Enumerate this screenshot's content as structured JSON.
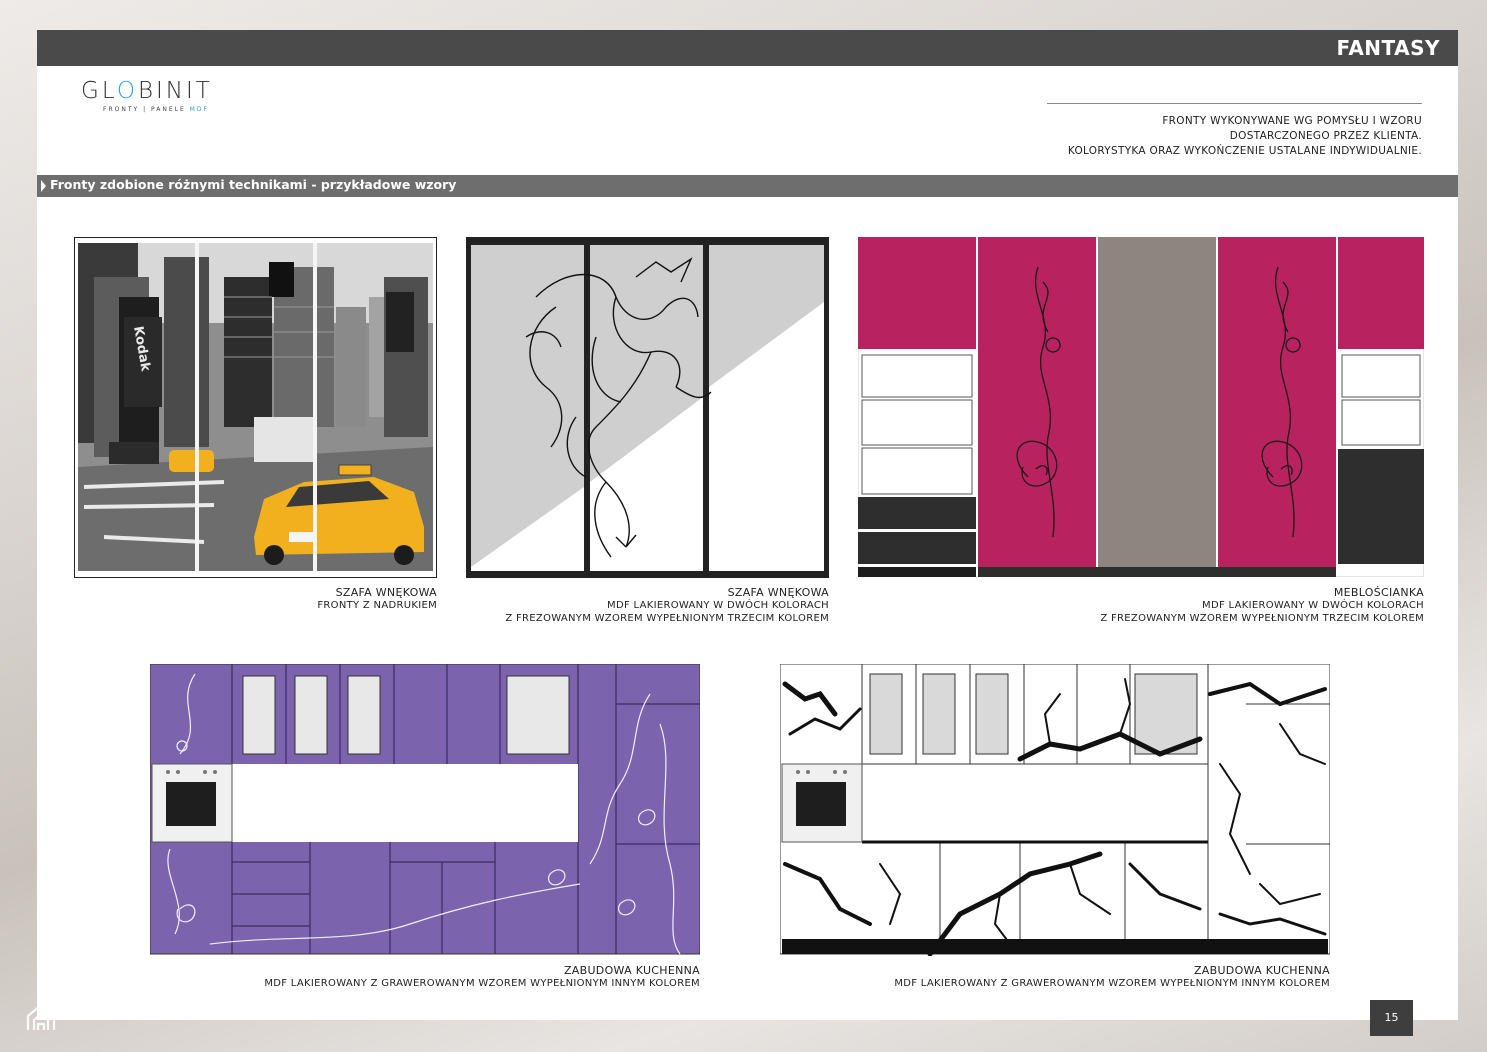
{
  "header": {
    "title": "FANTASY"
  },
  "logo": {
    "brand_part1": "GL",
    "brand_accent": "O",
    "brand_part2": "BINIT",
    "tagline_main": "FRONTY | PANELE",
    "tagline_accent": "MDF"
  },
  "intro": {
    "line1": "FRONTY WYKONYWANE WG POMYSŁU I WZORU",
    "line2": "DOSTARCZONEGO PRZEZ KLIENTA.",
    "line3": "KOLORYSTYKA ORAZ WYKOŃCZENIE USTALANE INDYWIDUALNIE."
  },
  "section": {
    "title": "Fronty zdobione różnymi technikami - przykładowe wzory"
  },
  "items": [
    {
      "title": "SZAFA WNĘKOWA",
      "line1": "FRONTY Z NADRUKIEM",
      "line2": ""
    },
    {
      "title": "SZAFA WNĘKOWA",
      "line1": "MDF LAKIEROWANY W DWÓCH KOLORACH",
      "line2": "Z FREZOWANYM WZOREM WYPEŁNIONYM TRZECIM KOLOREM"
    },
    {
      "title": "MEBLOŚCIANKA",
      "line1": "MDF LAKIEROWANY W DWÓCH KOLORACH",
      "line2": "Z FREZOWANYM WZOREM WYPEŁNIONYM TRZECIM KOLOREM"
    },
    {
      "title": "ZABUDOWA KUCHENNA",
      "line1": "MDF LAKIEROWANY Z GRAWEROWANYM WZOREM WYPEŁNIONYM INNYM KOLOREM",
      "line2": ""
    },
    {
      "title": "ZABUDOWA KUCHENNA",
      "line1": "MDF LAKIEROWANY Z GRAWEROWANYM WZOREM WYPEŁNIONYM INNYM KOLOREM",
      "line2": ""
    }
  ],
  "page": {
    "number": "15"
  },
  "colors": {
    "header_bar": "#4a4a4a",
    "section_bar": "#6e6e6e",
    "logo_accent": "#2aa4d8",
    "magenta": "#b8235f",
    "violet": "#7b63ae",
    "taxi_yellow": "#f2b01e"
  },
  "icons": {
    "watermark": "house-icon"
  }
}
